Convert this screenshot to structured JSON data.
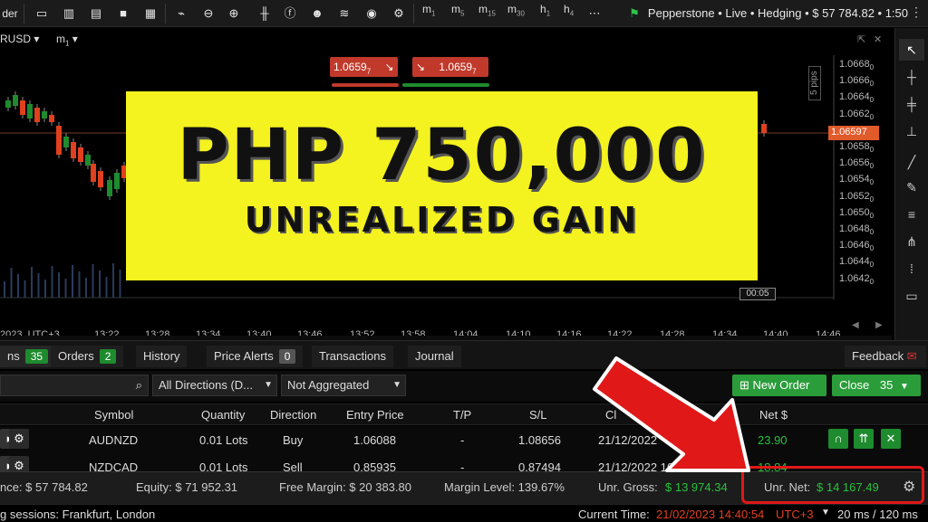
{
  "toolbar": {
    "left_button": "der",
    "timeframes": [
      {
        "label": "m",
        "sub": "1"
      },
      {
        "label": "m",
        "sub": "5"
      },
      {
        "label": "m",
        "sub": "15"
      },
      {
        "label": "m",
        "sub": "30"
      },
      {
        "label": "h",
        "sub": "1"
      },
      {
        "label": "h",
        "sub": "4"
      }
    ],
    "account": "Pepperstone • Live • Hedging • $ 57 784.82 • 1:50"
  },
  "chart": {
    "symbol": "RUSD ▾",
    "timeframe": "m",
    "timeframe_sub": "1",
    "sell_price": "1.0659",
    "sell_sup": "7",
    "buy_price": "1.0659",
    "buy_sup": "7",
    "pips_label": "5 pips",
    "current_price": "1.06597",
    "price_axis": [
      "1.0668",
      "1.0666",
      "1.0664",
      "1.0662",
      "1.0660",
      "1.0658",
      "1.0656",
      "1.0654",
      "1.0652",
      "1.0650",
      "1.0648",
      "1.0646",
      "1.0644",
      "1.0642"
    ],
    "price_axis_sub": [
      "0",
      "0",
      "0",
      "0",
      "0",
      "0",
      "0",
      "0",
      "0",
      "0",
      "0",
      "0",
      "0",
      "0"
    ],
    "time_axis": [
      "2023, UTC+3",
      "13:22",
      "13:28",
      "13:34",
      "13:40",
      "13:46",
      "13:52",
      "13:58",
      "14:04",
      "14:10",
      "14:16",
      "14:22",
      "14:28",
      "14:34",
      "14:40",
      "14:46"
    ],
    "countdown": "00:05",
    "colors": {
      "up": "#1e8b2e",
      "down": "#e0401e",
      "banner": "#f4f21f"
    }
  },
  "banner": {
    "amount": "PHP 750,000",
    "subtitle": "UNREALIZED GAIN"
  },
  "tabs": {
    "positions": {
      "label": "ns",
      "count": "35"
    },
    "orders": {
      "label": "Orders",
      "count": "2"
    },
    "history": {
      "label": "History"
    },
    "price_alerts": {
      "label": "Price Alerts",
      "count": "0"
    },
    "transactions": {
      "label": "Transactions"
    },
    "journal": {
      "label": "Journal"
    },
    "feedback": "Feedback"
  },
  "filters": {
    "directions": "All Directions (D...",
    "aggregation": "Not Aggregated",
    "new_order": "New Order",
    "close": "Close",
    "close_count": "35"
  },
  "table": {
    "headers": [
      "Symbol",
      "Quantity",
      "Direction",
      "Entry Price",
      "T/P",
      "S/L",
      "Cl",
      "Net $"
    ],
    "rows": [
      {
        "symbol": "AUDNZD",
        "quantity": "0.01 Lots",
        "direction": "Buy",
        "entry": "1.06088",
        "tp": "-",
        "sl": "1.08656",
        "created": "21/12/2022",
        "net": "23.90"
      },
      {
        "symbol": "NZDCAD",
        "quantity": "0.01 Lots",
        "direction": "Sell",
        "entry": "0.85935",
        "tp": "-",
        "sl": "0.87494",
        "created": "21/12/2022 16",
        "net": "18.84"
      }
    ]
  },
  "status": {
    "balance": "nce: $ 57 784.82",
    "equity": "Equity: $ 71 952.31",
    "free_margin": "Free Margin: $ 20 383.80",
    "margin_level": "Margin Level: 139.67%",
    "unr_gross_label": "Unr. Gross:",
    "unr_gross": "$ 13 974.34",
    "unr_net_label": "Unr. Net:",
    "unr_net": "$ 14 167.49"
  },
  "bottom": {
    "sessions": "g sessions: Frankfurt, London",
    "current_time_label": "Current Time:",
    "current_time": "21/02/2023 14:40:54",
    "tz": "UTC+3",
    "latency": "20 ms / 120 ms"
  }
}
